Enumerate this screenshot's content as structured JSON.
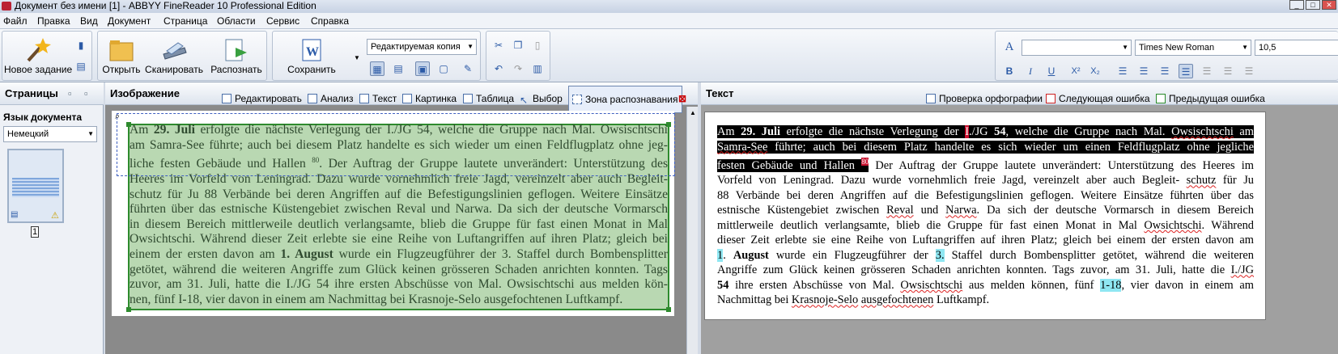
{
  "window": {
    "title": "Документ без имени [1] - ABBYY FineReader 10 Professional Edition",
    "min": "_",
    "max": "□",
    "close": "✕"
  },
  "menu": [
    "Файл",
    "Правка",
    "Вид",
    "Документ",
    "Страница",
    "Области",
    "Сервис",
    "Справка"
  ],
  "toolbar": {
    "new_task": "Новое задание",
    "open": "Открыть",
    "scan": "Сканировать",
    "recognize": "Распознать",
    "save": "Сохранить",
    "save_format": "Редактируемая копия",
    "font_name": "Times New Roman",
    "font_size": "10,5",
    "style_value": ""
  },
  "pages_pane": {
    "title": "Страницы",
    "lang_label": "Язык документа",
    "lang_value": "Немецкий",
    "page_number": "1"
  },
  "image_pane": {
    "title": "Изображение",
    "tools": [
      "Редактировать",
      "Анализ",
      "Текст",
      "Картинка",
      "Таблица",
      "Выбор",
      "Зона распознавания"
    ],
    "text_lines": [
      "Am 29. Juli erfolgte die nächste Verlegung der I./JG 54, welche die Gruppe nach Mal. Owsischtschi",
      "am Samra-See führte; auch bei diesem Platz handelte es sich wieder um einen Feldflugplatz ohne jeg-",
      "liche festen Gebäude und Hallen 80. Der Auftrag der Gruppe lautete unverändert: Unterstützung des",
      "Heeres im Vorfeld von Leningrad. Dazu wurde vornehmlich freie Jagd, vereinzelt aber auch Begleit-",
      "schutz für Ju 88 Verbände bei deren Angriffen auf die Befestigungslinien geflogen. Weitere Einsätze",
      "führten über das estnische Küstengebiet zwischen Reval und Narwa. Da sich der deutsche Vormarsch",
      "in diesem Bereich mittlerweile deutlich verlangsamte, blieb die Gruppe für fast einen Monat in Mal",
      "Owsichtschi. Während dieser Zeit erlebte sie eine Reihe von Luftangriffen auf ihren Platz; gleich bei",
      "einem der ersten davon am 1. August wurde ein Flugzeugführer der 3. Staffel durch Bombensplitter",
      "getötet, während die weiteren Angriffe zum Glück keinen grösseren Schaden anrichten konnten. Tags",
      "zuvor, am 31. Juli, hatte die I./JG 54 ihre ersten Abschüsse von Mal. Owsischtschi aus melden kön-",
      "nen, fünf I-18, vier davon in einem am Nachmittag bei Krasnoje-Selo ausgefochtenen Luftkampf."
    ]
  },
  "text_pane": {
    "title": "Текст",
    "tools": [
      "Проверка орфографии",
      "Следующая ошибка",
      "Предыдущая ошибка"
    ],
    "lines": [
      "Am 29. Juli erfolgte die nächste Verlegung der I./JG 54, welche die Gruppe nach Mal. Owsischtschi am",
      "Samra-See führte; auch bei diesem Platz handelte es sich wieder um einen Feldflugplatz ohne jegliche",
      "festen Gebäude und Hallen 80 Der Auftrag der Gruppe lautete unverändert: Unterstützung des Heeres im",
      "Vorfeld von Leningrad. Dazu wurde vornehmlich freie Jagd, vereinzelt aber auch Begleit- schutz für Ju",
      "88 Verbände bei deren Angriffen auf die Befestigungslinien geflogen. Weitere Einsätze führten über das",
      "estnische Küstengebiet zwischen Reval und Narwa. Da sich der deutsche Vormarsch in diesem Bereich",
      "mittlerweile deutlich verlangsamte, blieb die Gruppe für fast einen Monat in Mal Owsichtschi. Während",
      "dieser Zeit erlebte sie eine Reihe von Luftangriffen auf ihren Platz; gleich bei einem der ersten davon am",
      "1. August wurde ein Flugzeugführer der 3. Staffel durch Bombensplitter getötet, während die weiteren",
      "Angriffe zum Glück keinen grösseren Schaden anrichten konnten. Tags zuvor, am 31. Juli, hatte die I./JG",
      "54 ihre ersten Abschüsse von Mal. Owsischtschi aus melden können, fünf 1-18, vier davon in einem am",
      "Nachmittag bei Krasnoje-Selo ausgefochtenen Luftkampf."
    ]
  }
}
